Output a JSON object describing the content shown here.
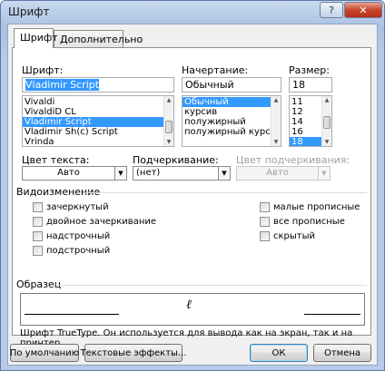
{
  "window": {
    "title": "Шрифт",
    "help_label": "?",
    "close_label": "✕"
  },
  "tabs": [
    {
      "label": "Шрифт",
      "active": true
    },
    {
      "label": "Дополнительно",
      "active": false
    }
  ],
  "font": {
    "label": "Шрифт:",
    "value": "Vladimir Script",
    "items": [
      "Vivaldi",
      "VivaldiD CL",
      "Vladimir Script",
      "Vladimir Sh(c) Script",
      "Vrinda"
    ],
    "selected_index": 2
  },
  "style": {
    "label": "Начертание:",
    "value": "Обычный",
    "items": [
      "Обычный",
      "курсив",
      "полужирный",
      "полужирный курсив"
    ],
    "selected_index": 0
  },
  "size": {
    "label": "Размер:",
    "value": "18",
    "items": [
      "11",
      "12",
      "14",
      "16",
      "18"
    ],
    "selected_index": 4
  },
  "text_color": {
    "label": "Цвет текста:",
    "value": "Авто"
  },
  "underline": {
    "label": "Подчеркивание:",
    "value": "(нет)"
  },
  "underline_color": {
    "label": "Цвет подчеркивания:",
    "value": "Авто",
    "enabled": false
  },
  "effects": {
    "title": "Видоизменение",
    "left": [
      "зачеркнутый",
      "двойное зачеркивание",
      "надстрочный",
      "подстрочный"
    ],
    "right": [
      "малые прописные",
      "все прописные",
      "скрытый"
    ]
  },
  "preview": {
    "title": "Образец",
    "sample": "ℓ",
    "description": "Шрифт TrueType. Он используется для вывода как на экран, так и на принтер."
  },
  "buttons": {
    "default": "По умолчанию",
    "text_effects": "Текстовые эффекты...",
    "ok": "ОК",
    "cancel": "Отмена"
  },
  "icons": {
    "dropdown": "▼",
    "scroll_up": "▲",
    "scroll_down": "▼"
  },
  "colors": {
    "selection": "#3399ff",
    "title_bar": "#b7cbe8",
    "close_button": "#c8452c"
  }
}
